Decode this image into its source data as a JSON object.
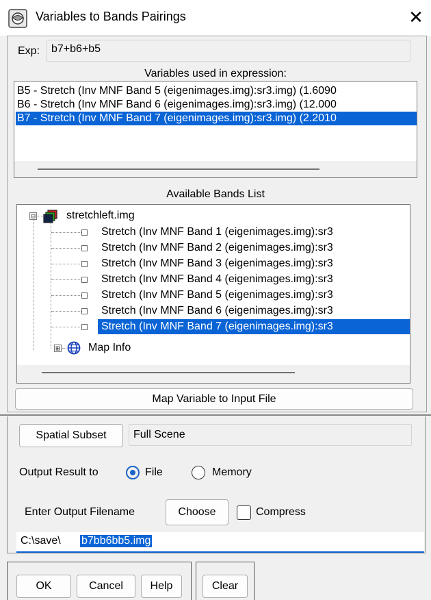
{
  "window": {
    "title": "Variables to Bands Pairings",
    "close_glyph": "✕"
  },
  "expression": {
    "label": "Exp:",
    "value": "b7+b6+b5"
  },
  "variables": {
    "heading": "Variables used in expression:",
    "items": [
      {
        "text": "B5 - Stretch (Inv MNF Band 5 (eigenimages.img):sr3.img) (1.6090",
        "selected": false
      },
      {
        "text": "B6 - Stretch (Inv MNF Band 6 (eigenimages.img):sr3.img) (12.000",
        "selected": false
      },
      {
        "text": "B7 - Stretch (Inv MNF Band 7 (eigenimages.img):sr3.img) (2.2010",
        "selected": true
      }
    ]
  },
  "bands": {
    "heading": "Available Bands List",
    "file": {
      "name": "stretchleft.img",
      "expander": "⊟"
    },
    "items": [
      {
        "text": "Stretch (Inv MNF Band 1 (eigenimages.img):sr3",
        "selected": false
      },
      {
        "text": "Stretch (Inv MNF Band 2 (eigenimages.img):sr3",
        "selected": false
      },
      {
        "text": "Stretch (Inv MNF Band 3 (eigenimages.img):sr3",
        "selected": false
      },
      {
        "text": "Stretch (Inv MNF Band 4 (eigenimages.img):sr3",
        "selected": false
      },
      {
        "text": "Stretch (Inv MNF Band 5 (eigenimages.img):sr3",
        "selected": false
      },
      {
        "text": "Stretch (Inv MNF Band 6 (eigenimages.img):sr3",
        "selected": false
      },
      {
        "text": "Stretch (Inv MNF Band 7 (eigenimages.img):sr3",
        "selected": true
      }
    ],
    "map_info": {
      "label": "Map Info",
      "expander": "⊞"
    }
  },
  "map_button": {
    "label": "Map Variable to Input File"
  },
  "subset": {
    "button_label": "Spatial Subset",
    "value": "Full Scene"
  },
  "output": {
    "label": "Output Result to",
    "options": [
      {
        "label": "File",
        "checked": true
      },
      {
        "label": "Memory",
        "checked": false
      }
    ]
  },
  "filename": {
    "label": "Enter Output Filename",
    "choose_label": "Choose",
    "compress_label": "Compress",
    "compress_checked": false,
    "path_prefix": "C:\\save\\",
    "path_selected": "b7bb6bb5.img"
  },
  "footer": {
    "ok_label": "OK",
    "cancel_label": "Cancel",
    "help_label": "Help",
    "clear_label": "Clear"
  },
  "colors": {
    "selection": "#0a64d6",
    "radio": "#1a64c8"
  }
}
